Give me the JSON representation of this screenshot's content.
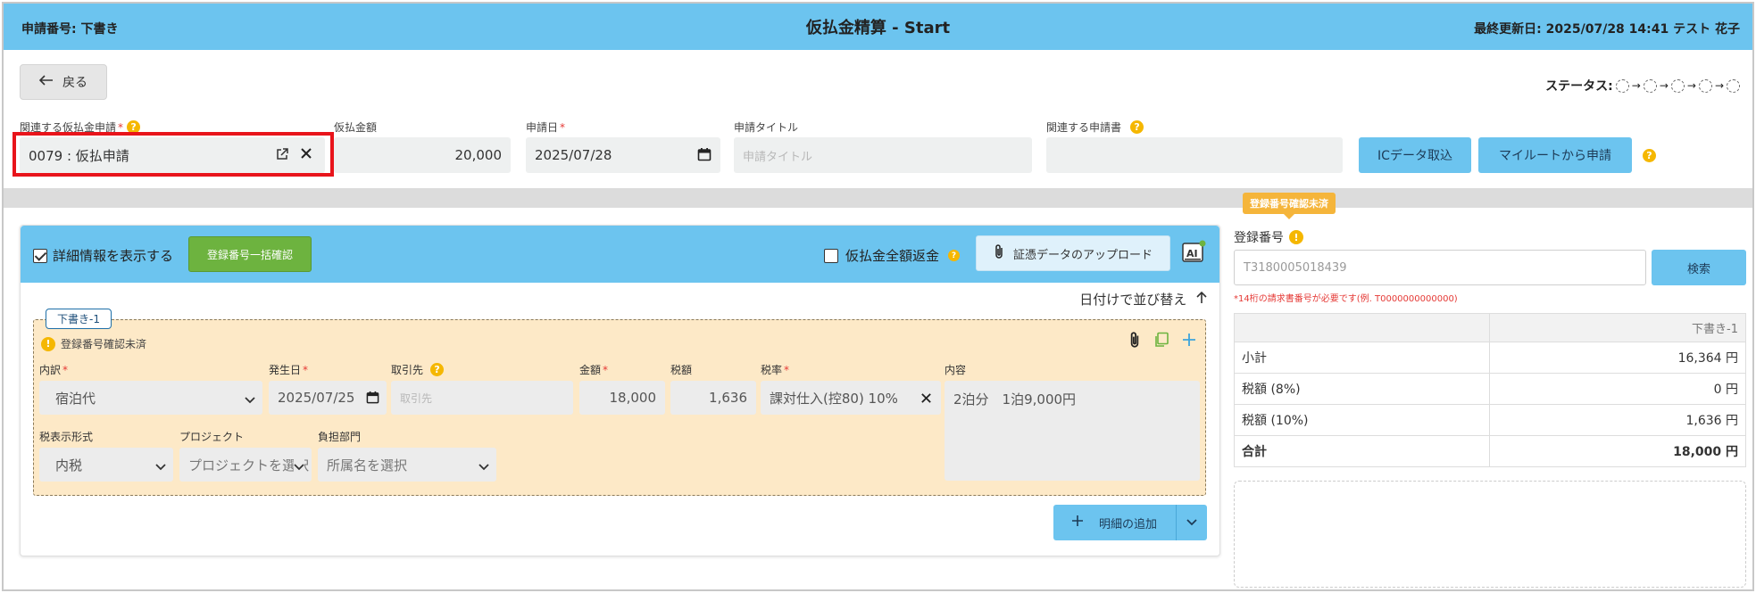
{
  "header": {
    "app_number": "申請番号: 下書き",
    "title": "仮払金精算 - Start",
    "last_updated": "最終更新日: 2025/07/28 14:41 テスト 花子"
  },
  "nav": {
    "back_label": "戻る"
  },
  "status": {
    "label": "ステータス:"
  },
  "form": {
    "related_advance": {
      "label": "関連する仮払金申請",
      "value": "0079 : 仮払申請"
    },
    "advance_amount": {
      "label": "仮払金額",
      "value": "20,000"
    },
    "application_date": {
      "label": "申請日",
      "value": "2025/07/28"
    },
    "application_title": {
      "label": "申請タイトル",
      "placeholder": "申請タイトル"
    },
    "related_document": {
      "label": "関連する申請書"
    },
    "ic_import_label": "ICデータ取込",
    "myroute_label": "マイルートから申請"
  },
  "panel": {
    "show_details_label": "詳細情報を表示する",
    "bulk_check_label": "登録番号一括確認",
    "full_refund_label": "仮払金全額返金",
    "upload_label": "証憑データのアップロード",
    "sort_label": "日付けで並び替え"
  },
  "line_item": {
    "tag": "下書き-1",
    "warning": "登録番号確認未済",
    "labels": {
      "category": "内訳",
      "date": "発生日",
      "vendor": "取引先",
      "amount": "金額",
      "tax": "税額",
      "tax_rate": "税率",
      "description": "内容",
      "tax_display": "税表示形式",
      "project": "プロジェクト",
      "department": "負担部門"
    },
    "values": {
      "category": "宿泊代",
      "date": "2025/07/25",
      "vendor_placeholder": "取引先",
      "amount": "18,000",
      "tax": "1,636",
      "tax_rate": "課対仕入(控80) 10%",
      "description": "2泊分　1泊9,000円",
      "tax_display": "内税",
      "project": "プロジェクトを選択",
      "department": "所属名を選択"
    }
  },
  "add_line_label": "明細の追加",
  "registration": {
    "bubble": "登録番号確認未済",
    "label": "登録番号",
    "placeholder": "T3180005018439",
    "search_label": "検索",
    "hint": "*14桁の請求書番号が必要です(例. T0000000000000)"
  },
  "summary": {
    "column": "下書き-1",
    "rows": [
      {
        "label": "小計",
        "value": "16,364 円"
      },
      {
        "label": "税額 (8%)",
        "value": "0 円"
      },
      {
        "label": "税額 (10%)",
        "value": "1,636 円"
      },
      {
        "label": "合計",
        "value": "18,000 円"
      }
    ]
  },
  "colors": {
    "header_blue": "#6cc4ef",
    "card_bg": "#fde9c7",
    "green": "#6db33f",
    "warning_amber": "#f5b700",
    "highlight_red": "#e8141b"
  }
}
